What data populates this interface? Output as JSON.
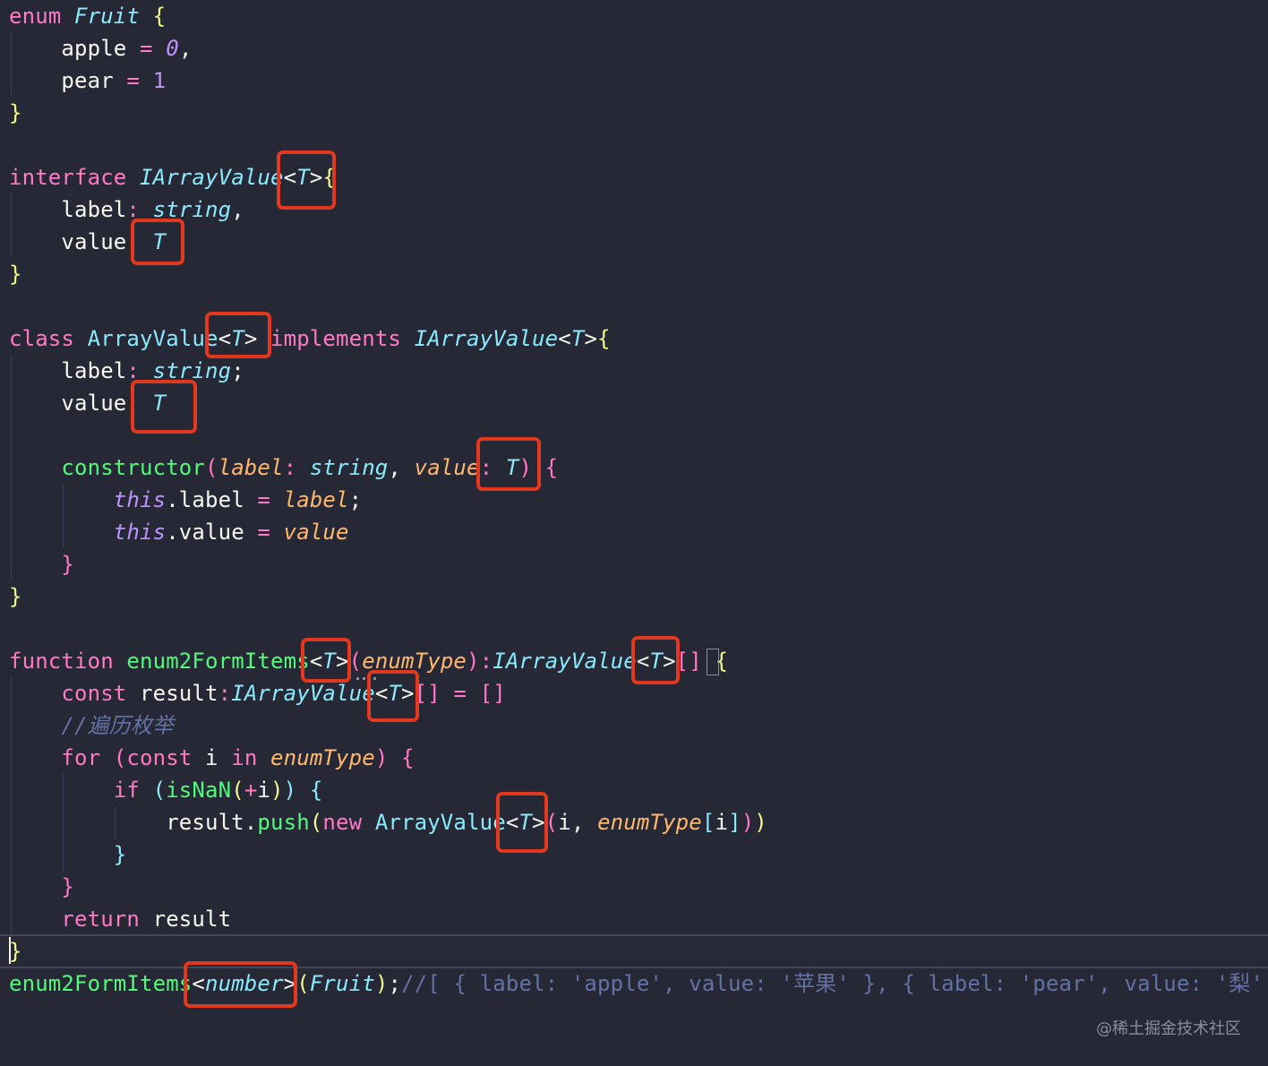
{
  "palette": {
    "background": "#262835",
    "keyword": "#ff79c6",
    "type": "#8be9fd",
    "function": "#50fa7b",
    "parameter": "#ffb86c",
    "number": "#bd93f9",
    "string": "#f1fa8c",
    "comment": "#6272a4",
    "bracket_yellow": "#f1fa8c",
    "bracket_pink": "#ff79c6",
    "bracket_blue": "#8be9fd",
    "highlight_box": "#e2381e"
  },
  "code_lines": [
    {
      "tokens": [
        {
          "t": "enum ",
          "c": "keyword"
        },
        {
          "t": "Fruit",
          "c": "type",
          "i": true
        },
        {
          "t": " ",
          "c": "plain"
        },
        {
          "t": "{",
          "c": "bracket_yellow"
        }
      ]
    },
    {
      "tokens": [
        {
          "t": "    apple ",
          "c": "plain"
        },
        {
          "t": "=",
          "c": "keyword"
        },
        {
          "t": " ",
          "c": "plain"
        },
        {
          "t": "0",
          "c": "number",
          "i": true
        },
        {
          "t": ",",
          "c": "plain"
        }
      ]
    },
    {
      "tokens": [
        {
          "t": "    pear ",
          "c": "plain"
        },
        {
          "t": "=",
          "c": "keyword"
        },
        {
          "t": " ",
          "c": "plain"
        },
        {
          "t": "1",
          "c": "number"
        }
      ]
    },
    {
      "tokens": [
        {
          "t": "}",
          "c": "bracket_yellow"
        }
      ]
    },
    {
      "tokens": []
    },
    {
      "tokens": [
        {
          "t": "interface ",
          "c": "keyword"
        },
        {
          "t": "IArrayValue",
          "c": "type",
          "i": true
        },
        {
          "t": "<",
          "c": "plain"
        },
        {
          "t": "T",
          "c": "type",
          "i": true
        },
        {
          "t": ">",
          "c": "plain"
        },
        {
          "t": "{",
          "c": "bracket_yellow"
        }
      ]
    },
    {
      "tokens": [
        {
          "t": "    label",
          "c": "plain"
        },
        {
          "t": ": ",
          "c": "keyword"
        },
        {
          "t": "string",
          "c": "type",
          "i": true
        },
        {
          "t": ",",
          "c": "plain"
        }
      ]
    },
    {
      "tokens": [
        {
          "t": "    value",
          "c": "plain"
        },
        {
          "t": ": ",
          "c": "keyword"
        },
        {
          "t": "T",
          "c": "type",
          "i": true
        }
      ]
    },
    {
      "tokens": [
        {
          "t": "}",
          "c": "bracket_yellow"
        }
      ]
    },
    {
      "tokens": []
    },
    {
      "tokens": [
        {
          "t": "class ",
          "c": "keyword"
        },
        {
          "t": "ArrayValue",
          "c": "type"
        },
        {
          "t": "<",
          "c": "plain"
        },
        {
          "t": "T",
          "c": "type",
          "i": true
        },
        {
          "t": "> ",
          "c": "plain"
        },
        {
          "t": "implements ",
          "c": "keyword"
        },
        {
          "t": "IArrayValue",
          "c": "type",
          "i": true
        },
        {
          "t": "<",
          "c": "plain"
        },
        {
          "t": "T",
          "c": "type",
          "i": true
        },
        {
          "t": ">",
          "c": "plain"
        },
        {
          "t": "{",
          "c": "bracket_yellow"
        }
      ]
    },
    {
      "tokens": [
        {
          "t": "    label",
          "c": "plain"
        },
        {
          "t": ": ",
          "c": "keyword"
        },
        {
          "t": "string",
          "c": "type",
          "i": true
        },
        {
          "t": ";",
          "c": "plain"
        }
      ]
    },
    {
      "tokens": [
        {
          "t": "    value",
          "c": "plain"
        },
        {
          "t": ": ",
          "c": "keyword"
        },
        {
          "t": "T",
          "c": "type",
          "i": true
        }
      ]
    },
    {
      "tokens": []
    },
    {
      "tokens": [
        {
          "t": "    constructor",
          "c": "function"
        },
        {
          "t": "(",
          "c": "bracket_pink"
        },
        {
          "t": "label",
          "c": "parameter",
          "i": true
        },
        {
          "t": ": ",
          "c": "keyword"
        },
        {
          "t": "string",
          "c": "type",
          "i": true
        },
        {
          "t": ", ",
          "c": "plain"
        },
        {
          "t": "value",
          "c": "parameter",
          "i": true
        },
        {
          "t": ": ",
          "c": "keyword"
        },
        {
          "t": "T",
          "c": "type",
          "i": true
        },
        {
          "t": ")",
          "c": "bracket_pink"
        },
        {
          "t": " ",
          "c": "plain"
        },
        {
          "t": "{",
          "c": "bracket_pink"
        }
      ]
    },
    {
      "tokens": [
        {
          "t": "        ",
          "c": "plain"
        },
        {
          "t": "this",
          "c": "number",
          "i": true
        },
        {
          "t": ".label ",
          "c": "plain"
        },
        {
          "t": "=",
          "c": "keyword"
        },
        {
          "t": " ",
          "c": "plain"
        },
        {
          "t": "label",
          "c": "parameter",
          "i": true
        },
        {
          "t": ";",
          "c": "plain"
        }
      ]
    },
    {
      "tokens": [
        {
          "t": "        ",
          "c": "plain"
        },
        {
          "t": "this",
          "c": "number",
          "i": true
        },
        {
          "t": ".value ",
          "c": "plain"
        },
        {
          "t": "=",
          "c": "keyword"
        },
        {
          "t": " ",
          "c": "plain"
        },
        {
          "t": "value",
          "c": "parameter",
          "i": true
        }
      ]
    },
    {
      "tokens": [
        {
          "t": "    }",
          "c": "bracket_pink"
        }
      ]
    },
    {
      "tokens": [
        {
          "t": "}",
          "c": "bracket_yellow"
        }
      ]
    },
    {
      "tokens": []
    },
    {
      "tokens": [
        {
          "t": "function ",
          "c": "keyword"
        },
        {
          "t": "enum2FormItems",
          "c": "function"
        },
        {
          "t": "<",
          "c": "plain"
        },
        {
          "t": "T",
          "c": "type",
          "i": true
        },
        {
          "t": ">",
          "c": "plain"
        },
        {
          "t": "(",
          "c": "bracket_pink"
        },
        {
          "t": "enumType",
          "c": "parameter",
          "i": true
        },
        {
          "t": ")",
          "c": "bracket_pink"
        },
        {
          "t": ":",
          "c": "keyword"
        },
        {
          "t": "IArrayValue",
          "c": "type",
          "i": true
        },
        {
          "t": "<",
          "c": "plain"
        },
        {
          "t": "T",
          "c": "type",
          "i": true
        },
        {
          "t": ">",
          "c": "plain"
        },
        {
          "t": "[]",
          "c": "bracket_pink"
        },
        {
          "t": " ",
          "c": "plain"
        },
        {
          "t": "{",
          "c": "bracket_yellow"
        }
      ]
    },
    {
      "tokens": [
        {
          "t": "    const ",
          "c": "keyword"
        },
        {
          "t": "result",
          "c": "plain"
        },
        {
          "t": ":",
          "c": "keyword"
        },
        {
          "t": "IArrayValue",
          "c": "type",
          "i": true
        },
        {
          "t": "<",
          "c": "plain"
        },
        {
          "t": "T",
          "c": "type",
          "i": true
        },
        {
          "t": ">",
          "c": "plain"
        },
        {
          "t": "[] ",
          "c": "bracket_pink"
        },
        {
          "t": "=",
          "c": "keyword"
        },
        {
          "t": " ",
          "c": "plain"
        },
        {
          "t": "[]",
          "c": "bracket_pink"
        }
      ]
    },
    {
      "tokens": [
        {
          "t": "    //遍历枚举",
          "c": "comment",
          "i": true
        }
      ]
    },
    {
      "tokens": [
        {
          "t": "    for ",
          "c": "keyword"
        },
        {
          "t": "(",
          "c": "bracket_pink"
        },
        {
          "t": "const ",
          "c": "keyword"
        },
        {
          "t": "i ",
          "c": "plain"
        },
        {
          "t": "in ",
          "c": "keyword"
        },
        {
          "t": "enumType",
          "c": "parameter",
          "i": true
        },
        {
          "t": ")",
          "c": "bracket_pink"
        },
        {
          "t": " ",
          "c": "plain"
        },
        {
          "t": "{",
          "c": "bracket_pink"
        }
      ]
    },
    {
      "tokens": [
        {
          "t": "        if ",
          "c": "keyword"
        },
        {
          "t": "(",
          "c": "bracket_blue"
        },
        {
          "t": "isNaN",
          "c": "function"
        },
        {
          "t": "(",
          "c": "bracket_yellow"
        },
        {
          "t": "+",
          "c": "keyword"
        },
        {
          "t": "i",
          "c": "plain"
        },
        {
          "t": ")",
          "c": "bracket_yellow"
        },
        {
          "t": ")",
          "c": "bracket_blue"
        },
        {
          "t": " ",
          "c": "plain"
        },
        {
          "t": "{",
          "c": "bracket_blue"
        }
      ]
    },
    {
      "tokens": [
        {
          "t": "            result.",
          "c": "plain"
        },
        {
          "t": "push",
          "c": "function"
        },
        {
          "t": "(",
          "c": "bracket_yellow"
        },
        {
          "t": "new ",
          "c": "keyword"
        },
        {
          "t": "ArrayValue",
          "c": "type"
        },
        {
          "t": "<",
          "c": "plain"
        },
        {
          "t": "T",
          "c": "type",
          "i": true
        },
        {
          "t": ">",
          "c": "plain"
        },
        {
          "t": "(",
          "c": "bracket_pink"
        },
        {
          "t": "i, ",
          "c": "plain"
        },
        {
          "t": "enumType",
          "c": "parameter",
          "i": true
        },
        {
          "t": "[",
          "c": "bracket_blue"
        },
        {
          "t": "i",
          "c": "plain"
        },
        {
          "t": "]",
          "c": "bracket_blue"
        },
        {
          "t": ")",
          "c": "bracket_pink"
        },
        {
          "t": ")",
          "c": "bracket_yellow"
        }
      ]
    },
    {
      "tokens": [
        {
          "t": "        }",
          "c": "bracket_blue"
        }
      ]
    },
    {
      "tokens": [
        {
          "t": "    }",
          "c": "bracket_pink"
        }
      ]
    },
    {
      "tokens": [
        {
          "t": "    return ",
          "c": "keyword"
        },
        {
          "t": "result",
          "c": "plain"
        }
      ]
    },
    {
      "tokens": [
        {
          "t": "}",
          "c": "bracket_yellow"
        }
      ]
    },
    {
      "tokens": [
        {
          "t": "enum2FormItems",
          "c": "function"
        },
        {
          "t": "<",
          "c": "plain"
        },
        {
          "t": "number",
          "c": "type",
          "i": true
        },
        {
          "t": ">",
          "c": "plain"
        },
        {
          "t": "(",
          "c": "bracket_yellow"
        },
        {
          "t": "Fruit",
          "c": "type",
          "i": true
        },
        {
          "t": ")",
          "c": "bracket_yellow"
        },
        {
          "t": ";",
          "c": "plain"
        },
        {
          "t": "//[ { label: 'apple', value: '苹果' }, { label: 'pear', value: '梨' ]",
          "c": "comment"
        }
      ]
    }
  ],
  "watermark": "@稀土掘金技术社区"
}
